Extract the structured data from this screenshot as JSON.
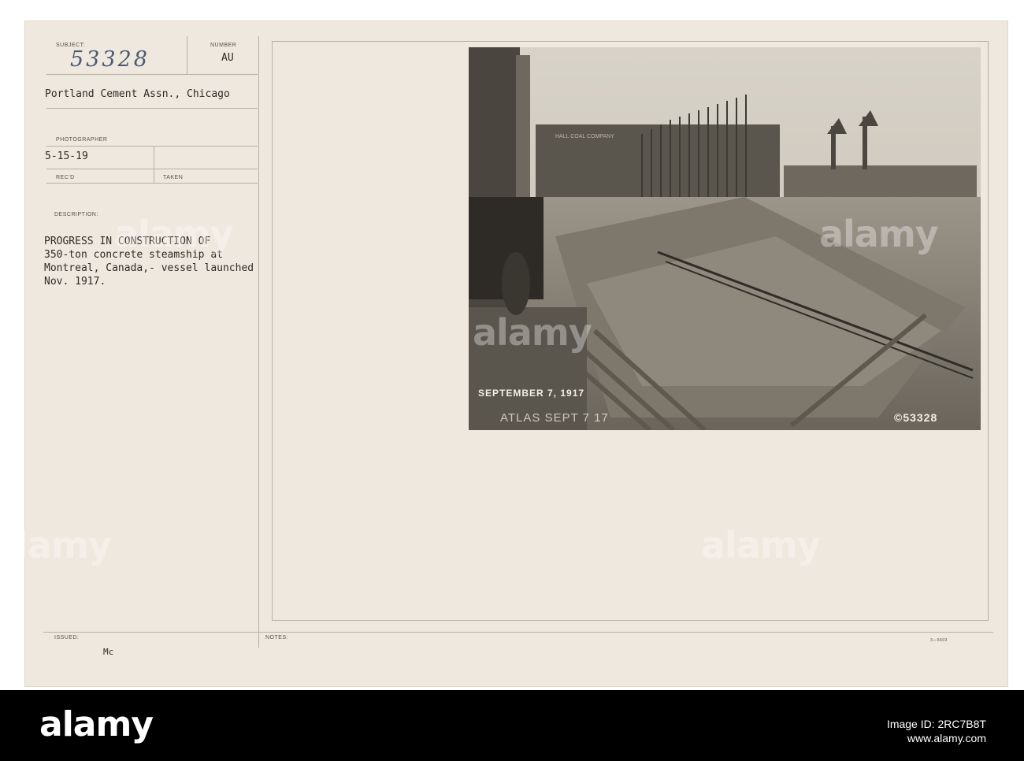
{
  "card": {
    "subject_label": "SUBJECT:",
    "subject_number_handwritten": "53328",
    "number_label": "NUMBER",
    "number_value": "AU",
    "source": "Portland Cement Assn., Chicago",
    "photographer_label": "PHOTOGRAPHER",
    "recd_date": "5-15-19",
    "recd_label": "REC'D",
    "taken_label": "TAKEN",
    "description_label": "DESCRIPTION:",
    "description_lines": [
      "PROGRESS IN CONSTRUCTION OF",
      "350-ton concrete steamship at",
      "Montreal, Canada,- vessel launched",
      "Nov. 1917."
    ],
    "issued_label": "ISSUED:",
    "issued_value": "Mc",
    "notes_label": "NOTES:",
    "form_number": "3—5603"
  },
  "photo": {
    "date_stamp": "SEPTEMBER 7, 1917",
    "atlas_stamp": "ATLAS SEPT 7 17",
    "negative_number": "©53328",
    "sign_text": "HALL COAL COMPANY"
  },
  "footer": {
    "brand": "alamy",
    "image_id_label": "Image ID: 2RC7B8T",
    "site": "www.alamy.com"
  },
  "watermark": "alamy"
}
